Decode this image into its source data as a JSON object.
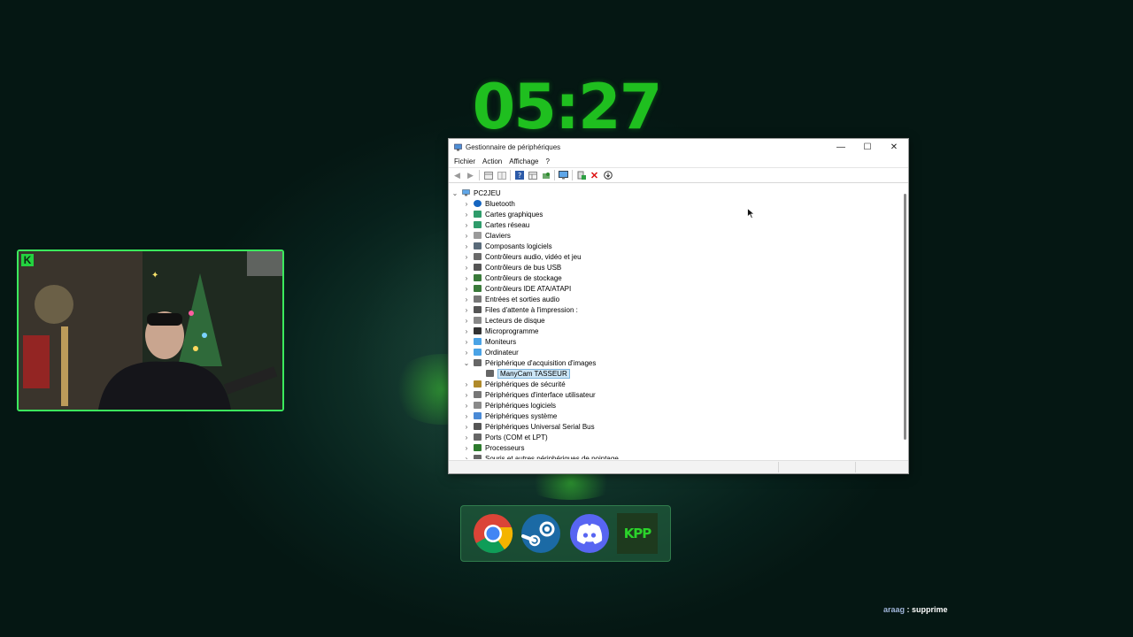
{
  "clock": {
    "time": "05:27"
  },
  "window": {
    "title": "Gestionnaire de périphériques",
    "controls": {
      "minimize": "—",
      "maximize": "☐",
      "close": "✕"
    },
    "menu": [
      "Fichier",
      "Action",
      "Affichage",
      "?"
    ],
    "tree": {
      "root": "PC2JEU",
      "items": [
        {
          "label": "Bluetooth",
          "icon": "bluetooth-icon",
          "expanded": false
        },
        {
          "label": "Cartes graphiques",
          "icon": "display-adapter-icon",
          "expanded": false
        },
        {
          "label": "Cartes réseau",
          "icon": "network-adapter-icon",
          "expanded": false
        },
        {
          "label": "Claviers",
          "icon": "keyboard-icon",
          "expanded": false
        },
        {
          "label": "Composants logiciels",
          "icon": "software-component-icon",
          "expanded": false
        },
        {
          "label": "Contrôleurs audio, vidéo et jeu",
          "icon": "audio-icon",
          "expanded": false
        },
        {
          "label": "Contrôleurs de bus USB",
          "icon": "usb-icon",
          "expanded": false
        },
        {
          "label": "Contrôleurs de stockage",
          "icon": "storage-icon",
          "expanded": false
        },
        {
          "label": "Contrôleurs IDE ATA/ATAPI",
          "icon": "ide-icon",
          "expanded": false
        },
        {
          "label": "Entrées et sorties audio",
          "icon": "speaker-icon",
          "expanded": false
        },
        {
          "label": "Files d'attente à l'impression :",
          "icon": "printer-icon",
          "expanded": false
        },
        {
          "label": "Lecteurs de disque",
          "icon": "disk-icon",
          "expanded": false
        },
        {
          "label": "Microprogramme",
          "icon": "firmware-icon",
          "expanded": false
        },
        {
          "label": "Moniteurs",
          "icon": "monitor-icon",
          "expanded": false
        },
        {
          "label": "Ordinateur",
          "icon": "computer-icon",
          "expanded": false
        },
        {
          "label": "Périphérique d'acquisition d'images",
          "icon": "camera-icon",
          "expanded": true
        },
        {
          "label": "ManyCam TASSEUR",
          "icon": "camera-device-icon",
          "child": true,
          "selected": true
        },
        {
          "label": "Périphériques de sécurité",
          "icon": "security-icon",
          "expanded": false
        },
        {
          "label": "Périphériques d'interface utilisateur",
          "icon": "hid-icon",
          "expanded": false
        },
        {
          "label": "Périphériques logiciels",
          "icon": "software-device-icon",
          "expanded": false
        },
        {
          "label": "Périphériques système",
          "icon": "system-icon",
          "expanded": false
        },
        {
          "label": "Périphériques Universal Serial Bus",
          "icon": "usb-device-icon",
          "expanded": false
        },
        {
          "label": "Ports (COM et LPT)",
          "icon": "port-icon",
          "expanded": false
        },
        {
          "label": "Processeurs",
          "icon": "processor-icon",
          "expanded": false
        },
        {
          "label": "Souris et autres périphériques de pointage",
          "icon": "mouse-icon",
          "expanded": false
        }
      ]
    }
  },
  "dock": {
    "apps": [
      "chrome-icon",
      "steam-icon",
      "discord-icon",
      "kpp-icon"
    ],
    "kpp_label": "KPP"
  },
  "webcam": {
    "logo": "K"
  },
  "chat": {
    "user": "araag",
    "separator": " : ",
    "message": "supprime"
  },
  "colors": {
    "accent": "#1fbf1f",
    "webcam_border": "#3bea5d",
    "selection": "#cde6f7"
  }
}
